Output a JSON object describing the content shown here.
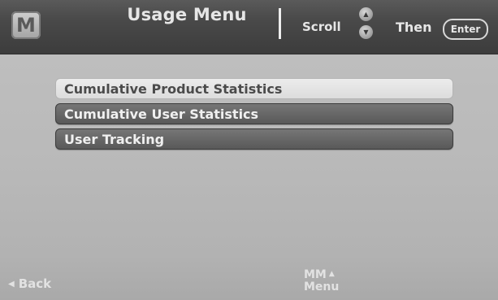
{
  "header": {
    "logo": "M",
    "title": "Usage Menu",
    "scroll_label": "Scroll",
    "then_label": "Then",
    "enter_label": "Enter",
    "scroll_up_icon": "up-arrow-icon",
    "scroll_down_icon": "down-arrow-icon"
  },
  "menu": {
    "items": [
      {
        "label": "Cumulative Product Statistics",
        "selected": true
      },
      {
        "label": "Cumulative User Statistics",
        "selected": false
      },
      {
        "label": "User Tracking",
        "selected": false
      }
    ]
  },
  "footer": {
    "back_label": "Back",
    "mm_label": "MM",
    "menu_label": "Menu"
  },
  "colors": {
    "header_bg": "#3c3c3c",
    "screen_bg": "#bebebe",
    "selected_item_bg": "#e4e4e4",
    "item_bg": "#5f5f5f"
  }
}
